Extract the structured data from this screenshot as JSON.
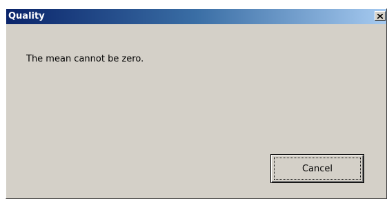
{
  "window": {
    "title": "Quality",
    "close_icon": "close-icon",
    "colors": {
      "titlebar_start": "#0a246a",
      "titlebar_end": "#a6caf0",
      "face": "#d4d0c8"
    }
  },
  "dialog": {
    "message": "The mean cannot be zero.",
    "cancel_label": "Cancel"
  }
}
